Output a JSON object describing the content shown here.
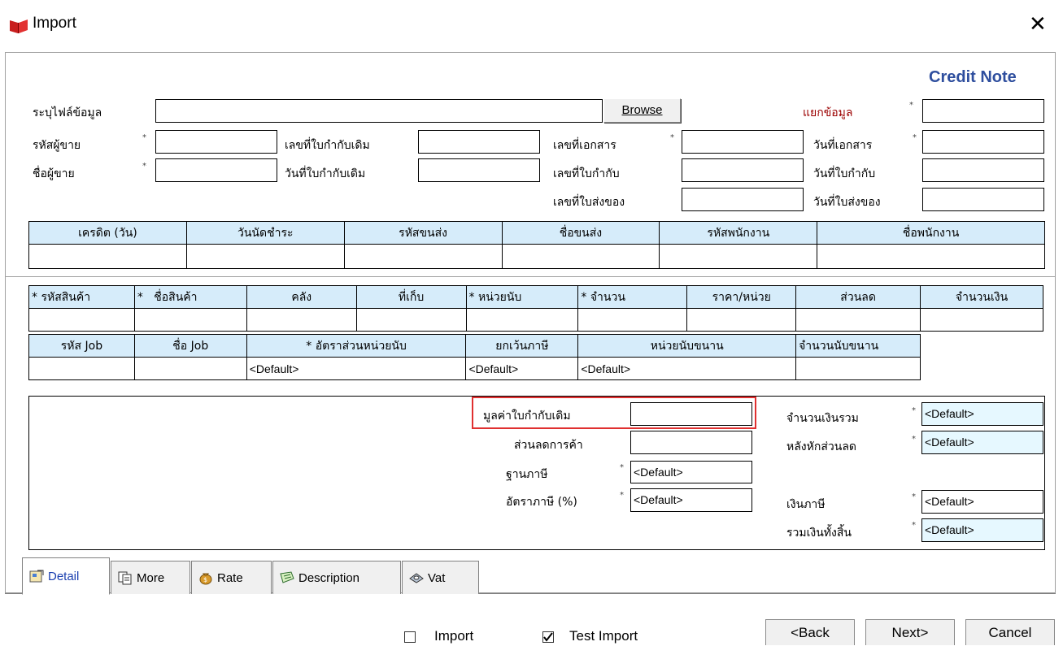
{
  "window": {
    "title": "Import",
    "close": "✕"
  },
  "header": {
    "doc_type": "Credit Note"
  },
  "form": {
    "file_label": "ระบุไฟล์ข้อมูล",
    "browse_label": "Browse",
    "split_label": "แยกข้อมูล",
    "seller_code_label": "รหัสผู้ขาย",
    "seller_name_label": "ชื่อผู้ขาย",
    "orig_inv_no_label": "เลขที่ใบกำกับเดิม",
    "orig_inv_date_label": "วันที่ใบกำกับเดิม",
    "doc_no_label": "เลขที่เอกสาร",
    "tax_inv_no_label": "เลขที่ใบกำกับ",
    "delivery_no_label": "เลขที่ใบส่งของ",
    "doc_date_label": "วันที่เอกสาร",
    "tax_inv_date_label": "วันที่ใบกำกับ",
    "delivery_date_label": "วันที่ใบส่งของ",
    "star": "*"
  },
  "grid1": {
    "headers": [
      "เครดิต (วัน)",
      "วันนัดชำระ",
      "รหัสขนส่ง",
      "ชื่อขนส่ง",
      "รหัสพนักงาน",
      "ชื่อพนักงาน"
    ]
  },
  "grid2": {
    "headers": [
      "* รหัสสินค้า",
      "*",
      "ชื่อสินค้า",
      "คลัง",
      "ที่เก็บ",
      "* หน่วยนับ",
      "* จำนวน",
      "ราคา/หน่วย",
      "ส่วนลด",
      "จำนวนเงิน"
    ],
    "headers2": [
      "รหัส Job",
      "ชื่อ Job",
      "* อัตราส่วนหน่วยนับ",
      "ยกเว้นภาษี",
      "หน่วยนับขนาน",
      "จำนวนนับขนาน"
    ],
    "values2": [
      "",
      "",
      "<Default>",
      "<Default>",
      "<Default>",
      ""
    ]
  },
  "totals": {
    "orig_value_label": "มูลค่าใบกำกับเดิม",
    "trade_discount_label": "ส่วนลดการค้า",
    "tax_base_label": "ฐานภาษี",
    "tax_rate_label": "อัตราภาษี (%)",
    "total_amount_label": "จำนวนเงินรวม",
    "after_discount_label": "หลังหักส่วนลด",
    "tax_amount_label": "เงินภาษี",
    "grand_total_label": "รวมเงินทั้งสิ้น",
    "default": "<Default>"
  },
  "tabs": [
    "Detail",
    "More",
    "Rate",
    "Description",
    "Vat"
  ],
  "footer": {
    "import_label": "Import",
    "test_import_label": "Test Import",
    "test_import_checked": true,
    "back": "<Back",
    "next": "Next>",
    "cancel": "Cancel"
  }
}
